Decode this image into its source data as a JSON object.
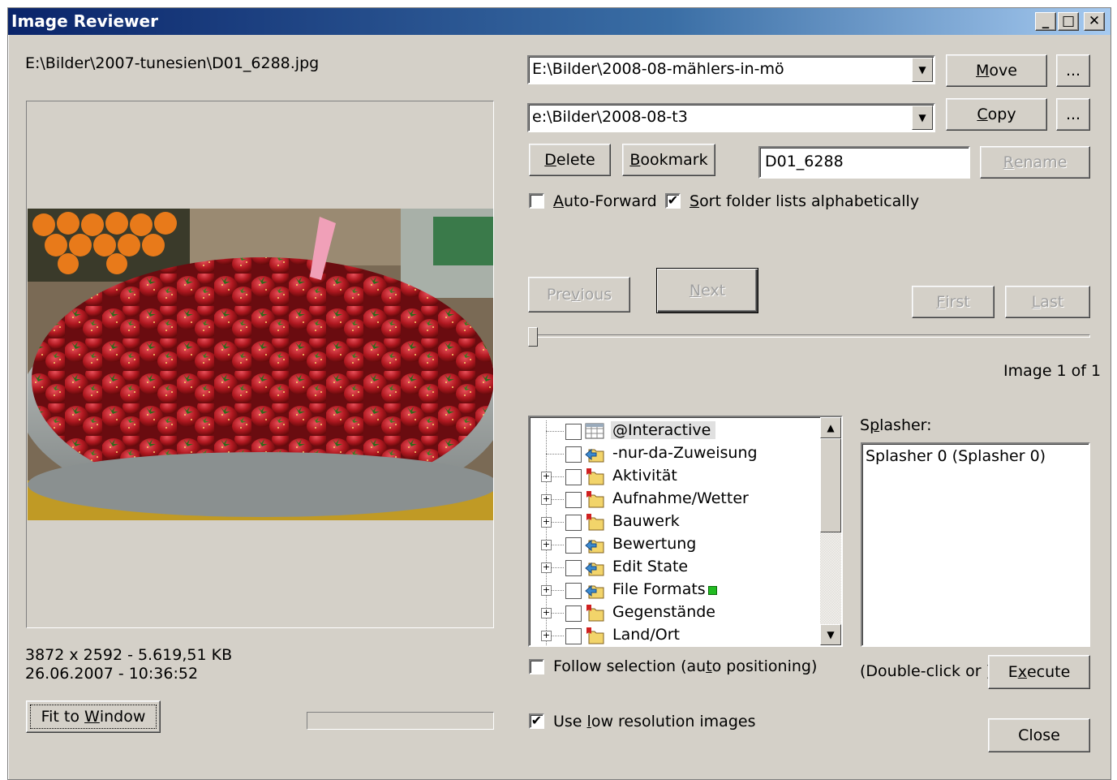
{
  "window": {
    "title": "Image Reviewer",
    "minimize_glyph": "_",
    "maximize_glyph": "□",
    "close_glyph": "✕"
  },
  "image_panel": {
    "file_path": "E:\\Bilder\\2007-tunesien\\D01_6288.jpg",
    "dimensions_size": "3872 x 2592 - 5.619,51 KB",
    "datetime": "26.06.2007 - 10:36:52",
    "fit_to_window_pre": "Fit to ",
    "fit_to_window_mn": "W",
    "fit_to_window_post": "indow"
  },
  "move_row": {
    "combo_value": "E:\\Bilder\\2008-08-mählers-in-mö",
    "button_mn": "M",
    "button_rest": "ove",
    "browse_label": "..."
  },
  "copy_row": {
    "combo_value": "e:\\Bilder\\2008-08-t3",
    "button_mn": "C",
    "button_rest": "opy",
    "browse_label": "..."
  },
  "actions": {
    "delete_mn": "D",
    "delete_rest": "elete",
    "bookmark_mn": "B",
    "bookmark_rest": "ookmark",
    "rename_value": "D01_6288",
    "rename_mn": "R",
    "rename_rest": "ename"
  },
  "options": {
    "auto_forward_mn": "A",
    "auto_forward_rest": "uto-Forward",
    "auto_forward_checked": false,
    "sort_mn": "S",
    "sort_rest": "ort folder lists alphabetically",
    "sort_checked": true
  },
  "navigation": {
    "previous_pre": "Pre",
    "previous_mn": "v",
    "previous_post": "ious",
    "next_mn": "N",
    "next_rest": "ext",
    "first_mn": "F",
    "first_rest": "irst",
    "last_mn": "L",
    "last_rest": "ast",
    "image_counter": "Image 1 of 1",
    "slider_position": 0
  },
  "tree": {
    "items": [
      {
        "label": "@Interactive",
        "expandable": false,
        "icon": "grid-icon"
      },
      {
        "label": "-nur-da-Zuweisung",
        "expandable": false,
        "icon": "folder-arrow-icon"
      },
      {
        "label": "Aktivität",
        "expandable": true,
        "icon": "folder-tag-icon"
      },
      {
        "label": "Aufnahme/Wetter",
        "expandable": true,
        "icon": "folder-tag-icon"
      },
      {
        "label": "Bauwerk",
        "expandable": true,
        "icon": "folder-tag-icon"
      },
      {
        "label": "Bewertung",
        "expandable": true,
        "icon": "folder-arrow-icon"
      },
      {
        "label": "Edit State",
        "expandable": true,
        "icon": "folder-arrow-icon"
      },
      {
        "label": "File Formats",
        "expandable": true,
        "icon": "folder-arrow-icon"
      },
      {
        "label": "Gegenstände",
        "expandable": true,
        "icon": "folder-tag-icon"
      },
      {
        "label": "Land/Ort",
        "expandable": true,
        "icon": "folder-tag-icon"
      }
    ],
    "follow_pre": "Follow selection (au",
    "follow_mn": "t",
    "follow_post": "o positioning)",
    "follow_checked": false,
    "lowres_pre": "Use ",
    "lowres_mn": "l",
    "lowres_post": "ow resolution images",
    "lowres_checked": true
  },
  "splasher": {
    "label_pre": "S",
    "label_mn": "p",
    "label_post": "lasher:",
    "list_items": [
      "Splasher 0 (Splasher 0)"
    ],
    "hint": "(Double-click or )",
    "execute_pre": "E",
    "execute_mn": "x",
    "execute_post": "ecute",
    "close_label": "Close"
  },
  "colors": {
    "dialog_bg": "#d4d0c8",
    "title_start": "#0a246a",
    "title_end": "#a6caf0",
    "green_marker": "#22bb22"
  }
}
